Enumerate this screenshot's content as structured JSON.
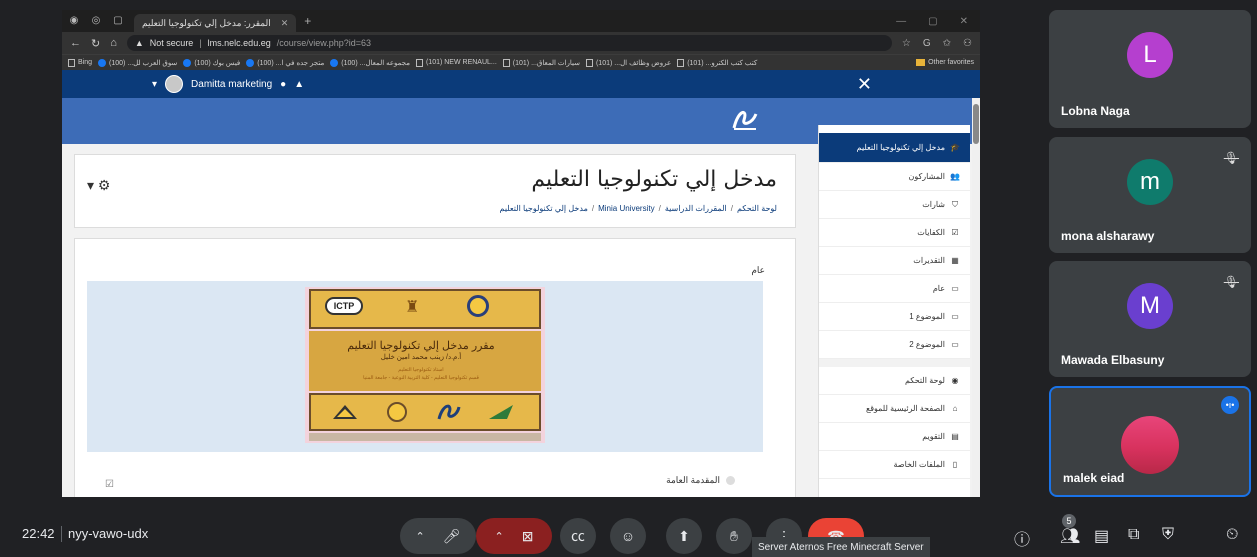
{
  "browser": {
    "tab_title": "المقرر: مدخل إلي تكنولوجيا التعليم",
    "not_secure": "Not secure",
    "url_host": "lms.nelc.edu.eg",
    "url_path": "/course/view.php?id=63",
    "bookmarks": [
      "Bing",
      "سوق العرب لل... (100)",
      "فيس بوك (100)",
      "متجر جده في ا... (100)",
      "مجموعه المعال... (100)",
      "(101) NEW RENAUL...",
      "سيارات المعاق... (101)",
      "عروض وظائف ال... (101)",
      "كتب كتب الكترو... (101)"
    ],
    "other_favorites": "Other favorites"
  },
  "moodle": {
    "user_name": "Damitta marketing",
    "course_title": "مدخل إلي تكنولوجيا التعليم",
    "breadcrumb": [
      "لوحة التحكم",
      "المقررات الدراسية",
      "Minia University",
      "مدخل إلي تكنولوجيا التعليم"
    ],
    "section_general": "عام",
    "section_intro": "المقدمة العامة",
    "poster": {
      "ictp": "ICTP",
      "title": "مقرر مدخل إلي تكنولوجيا التعليم",
      "author": "أ.م.د/ زينب محمد امين خليل",
      "line1": "استاذ تكنولوجيا التعليم",
      "line2": "قسم تكنولوجيا التعليم - كلية التربية النوعية - جامعة المنيا"
    },
    "sidebar": [
      {
        "label": "مدخل إلي تكنولوجيا التعليم",
        "icon": "graduation-cap-icon",
        "glyph": "🎓",
        "active": true
      },
      {
        "label": "المشاركون",
        "icon": "users-icon",
        "glyph": "👥"
      },
      {
        "label": "شارات",
        "icon": "shield-icon",
        "glyph": "⛉"
      },
      {
        "label": "الكفايات",
        "icon": "checkbox-icon",
        "glyph": "☑"
      },
      {
        "label": "التقديرات",
        "icon": "table-icon",
        "glyph": "▦"
      },
      {
        "label": "عام",
        "icon": "folder-icon",
        "glyph": "▭"
      },
      {
        "label": "الموضوع 1",
        "icon": "folder-icon",
        "glyph": "▭"
      },
      {
        "label": "الموضوع 2",
        "icon": "folder-icon",
        "glyph": "▭"
      },
      {
        "label": "لوحة التحكم",
        "icon": "dashboard-icon",
        "glyph": "◉",
        "gap_before": true
      },
      {
        "label": "الصفحة الرئيسية للموقع",
        "icon": "home-icon",
        "glyph": "⌂"
      },
      {
        "label": "التقويم",
        "icon": "calendar-icon",
        "glyph": "▤"
      },
      {
        "label": "الملفات الخاصة",
        "icon": "file-icon",
        "glyph": "▯"
      }
    ]
  },
  "participants": [
    {
      "name": "Lobna Naga",
      "initial": "L",
      "color": "#b53fcf",
      "muted": false
    },
    {
      "name": "mona alsharawy",
      "initial": "m",
      "color": "#0f7b6c",
      "muted": true
    },
    {
      "name": "Mawada Elbasuny",
      "initial": "M",
      "color": "#6a3fcf",
      "muted": true
    },
    {
      "name": "malek eiad",
      "initial": "",
      "color": "#e83e6b",
      "muted": false,
      "speaking": true
    }
  ],
  "meet": {
    "time": "22:42",
    "code": "nyy-vawo-udx",
    "participant_count": "5",
    "tooltip": "Server  Aternos  Free Minecraft Server"
  }
}
